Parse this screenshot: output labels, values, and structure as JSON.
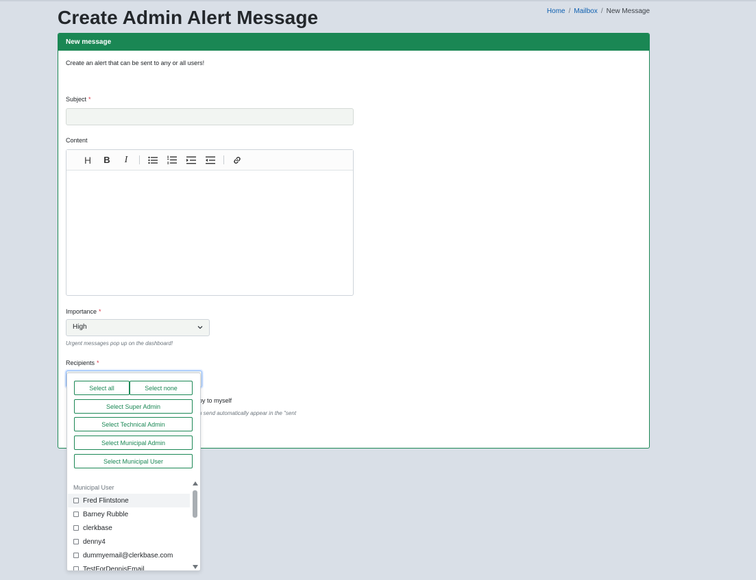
{
  "page": {
    "title": "Create Admin Alert Message"
  },
  "breadcrumb": {
    "home": "Home",
    "mailbox": "Mailbox",
    "current": "New Message",
    "sep": "/"
  },
  "card": {
    "header": "New message",
    "intro": "Create an alert that can be sent to any or all users!"
  },
  "form": {
    "subject": {
      "label": "Subject",
      "required": "*",
      "value": ""
    },
    "content": {
      "label": "Content"
    },
    "toolbar": {
      "heading": "H",
      "bold": "B",
      "italic": "I"
    },
    "importance": {
      "label": "Importance",
      "required": "*",
      "value": "High",
      "help": "Urgent messages pop up on the dashboard!"
    },
    "recipients": {
      "label": "Recipients",
      "required": "*",
      "value": ""
    },
    "copy_partial": "py to myself",
    "copy_help_partial": "u send automatically appear in the \"sent"
  },
  "dropdown": {
    "select_all": "Select all",
    "select_none": "Select none",
    "select_super_admin": "Select Super Admin",
    "select_technical_admin": "Select Technical Admin",
    "select_municipal_admin": "Select Municipal Admin",
    "select_municipal_user": "Select Municipal User",
    "group_label": "Municipal User",
    "options": [
      "Fred Flintstone",
      "Barney Rubble",
      "clerkbase",
      "denny4",
      "dummyemail@clerkbase.com",
      "TestForDennisEmail"
    ]
  },
  "colors": {
    "primary": "#1a8754",
    "background": "#d9dfe7",
    "required": "#dc3545"
  }
}
